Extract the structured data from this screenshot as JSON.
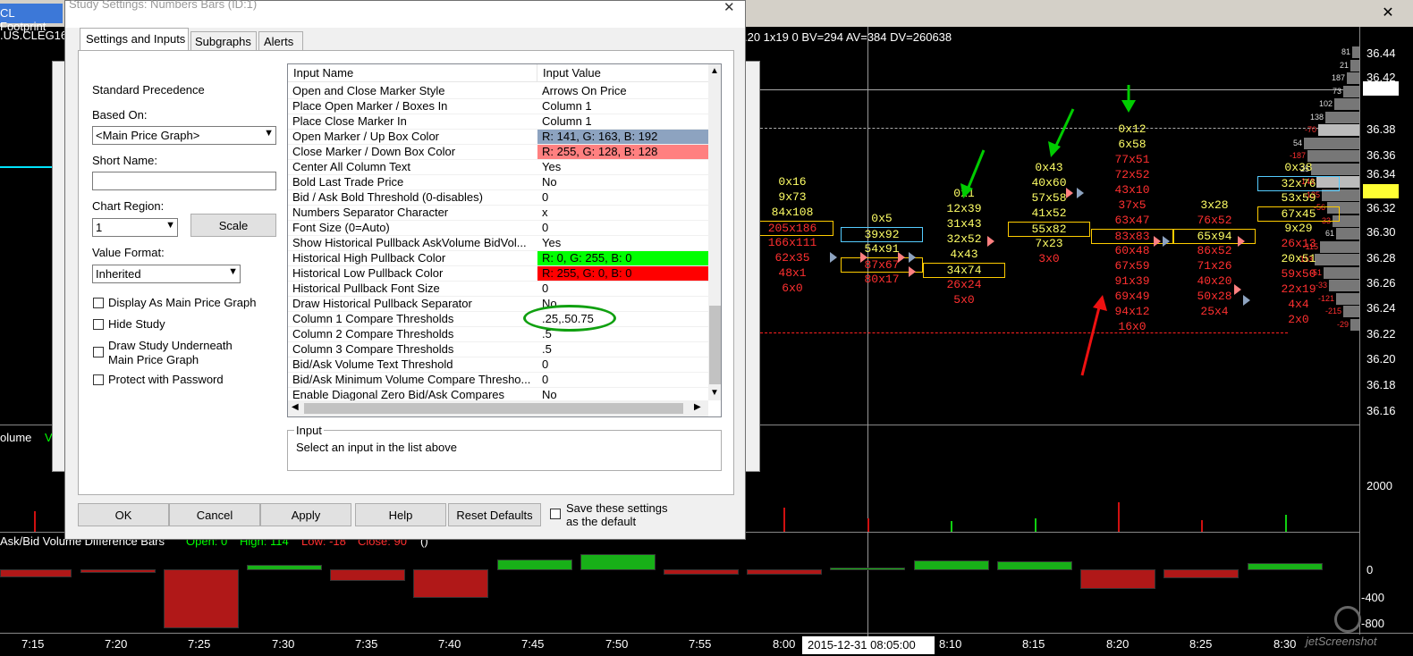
{
  "chart": {
    "tab_title": "CL Footprint",
    "symbol_fragment": ".US.CLEG16",
    "header_stats": ".20  1x19  0  BV=294  AV=384  DV=260638",
    "volume_label": "olume",
    "volume_value_fragment": "V",
    "diff_label": "Ask/Bid Volume Difference Bars",
    "diff_open": "Open: 0",
    "diff_high": "High: 114",
    "diff_low": "Low: -18",
    "diff_close": "Close: 90",
    "diff_paren": "()",
    "cursor_time": "2015-12-31  08:05:00",
    "watermark": "jetScreenshot",
    "price_ticks": [
      "36.44",
      "36.42",
      "36.41",
      "36.38",
      "36.36",
      "36.34",
      "36.33",
      "36.32",
      "36.30",
      "36.28",
      "36.26",
      "36.24",
      "36.22",
      "36.20",
      "36.18",
      "36.16"
    ],
    "volume_ticks": [
      "2000"
    ],
    "diff_ticks": [
      "0",
      "-400",
      "-800"
    ],
    "time_ticks": [
      "7:15",
      "7:20",
      "7:25",
      "7:30",
      "7:35",
      "7:40",
      "7:45",
      "7:50",
      "7:55",
      "8:00",
      "8:10",
      "8:15",
      "8:20",
      "8:25",
      "8:30"
    ],
    "profile_values": [
      "81",
      "21",
      "187",
      "73",
      "102",
      "138",
      "-70",
      "54",
      "-187",
      "25",
      "-143",
      "-135",
      "-56",
      "-33",
      "61",
      "-115",
      "-113",
      "-51",
      "-33",
      "-121",
      "-215",
      "-29"
    ],
    "footprint_cols": [
      {
        "cells": [
          "0x16",
          "9x73",
          "84x108",
          "205x186",
          "166x111",
          "62x35",
          "48x1",
          "6x0"
        ]
      },
      {
        "cells": [
          "0x5",
          "39x92",
          "54x91",
          "87x67",
          "80x17"
        ]
      },
      {
        "cells": [
          "0x1",
          "12x39",
          "31x43",
          "32x52",
          "4x43",
          "34x74",
          "26x24",
          "5x0"
        ]
      },
      {
        "cells": [
          "0x43",
          "40x60",
          "57x58",
          "41x52",
          "55x82",
          "7x23",
          "3x0"
        ]
      },
      {
        "cells": [
          "0x12",
          "6x58",
          "77x51",
          "72x52",
          "43x10",
          "37x5",
          "63x47",
          "83x83",
          "60x48",
          "67x59",
          "91x39",
          "69x49",
          "94x12",
          "16x0"
        ]
      },
      {
        "cells": [
          "3x28",
          "76x52",
          "65x94",
          "86x52",
          "71x26",
          "40x20",
          "50x28",
          "25x4"
        ]
      },
      {
        "cells": [
          "0x38",
          "32x76",
          "53x59",
          "67x45",
          "9x29",
          "26x13",
          "20x51",
          "59x50",
          "22x19",
          "4x4",
          "2x0"
        ]
      }
    ],
    "colors": {
      "green": "#00ff00",
      "red": "#ff3030",
      "yellow": "#ffff66",
      "cyan": "#00ffff"
    }
  },
  "dialog": {
    "title": "Study Settings: Numbers Bars (ID:1)",
    "tabs": [
      "Settings and Inputs",
      "Subgraphs",
      "Alerts"
    ],
    "standard_precedence": "Standard Precedence",
    "based_on_label": "Based On:",
    "based_on_value": "<Main Price Graph>",
    "short_name_label": "Short Name:",
    "short_name_value": "",
    "chart_region_label": "Chart Region:",
    "chart_region_value": "1",
    "scale_button": "Scale",
    "value_format_label": "Value Format:",
    "value_format_value": "Inherited",
    "checkboxes": [
      "Display As Main Price Graph",
      "Hide Study",
      "Draw Study Underneath\nMain Price Graph",
      "Protect with Password"
    ],
    "grid_header": [
      "Input Name",
      "Input Value"
    ],
    "inputs": [
      {
        "name": "Open and Close Marker Style",
        "value": "Arrows On Price",
        "bg": ""
      },
      {
        "name": "Place Open Marker / Boxes In",
        "value": "Column 1",
        "bg": ""
      },
      {
        "name": "Place Close Marker In",
        "value": "Column 1",
        "bg": ""
      },
      {
        "name": "Open Marker / Up Box Color",
        "value": "R: 141, G: 163, B: 192",
        "bg": "#8da3c0"
      },
      {
        "name": "Close Marker / Down Box Color",
        "value": "R: 255, G: 128, B: 128",
        "bg": "#ff8080"
      },
      {
        "name": "Center All Column Text",
        "value": "Yes",
        "bg": ""
      },
      {
        "name": "Bold Last Trade Price",
        "value": "No",
        "bg": ""
      },
      {
        "name": "Bid / Ask Bold Threshold (0-disables)",
        "value": "0",
        "bg": ""
      },
      {
        "name": "Numbers Separator Character",
        "value": "x",
        "bg": ""
      },
      {
        "name": "Font Size (0=Auto)",
        "value": "0",
        "bg": ""
      },
      {
        "name": "Show Historical Pullback AskVolume BidVol...",
        "value": "Yes",
        "bg": ""
      },
      {
        "name": "Historical High Pullback Color",
        "value": "R: 0, G: 255, B: 0",
        "bg": "#00ff00"
      },
      {
        "name": "Historical Low Pullback Color",
        "value": "R: 255, G: 0, B: 0",
        "bg": "#ff0000"
      },
      {
        "name": "Historical Pullback Font Size",
        "value": "0",
        "bg": ""
      },
      {
        "name": "Draw Historical Pullback Separator",
        "value": "No",
        "bg": ""
      },
      {
        "name": "Column 1 Compare Thresholds",
        "value": ".25,.50.75",
        "bg": ""
      },
      {
        "name": "Column 2 Compare Thresholds",
        "value": ".5",
        "bg": ""
      },
      {
        "name": "Column 3 Compare Thresholds",
        "value": ".5",
        "bg": ""
      },
      {
        "name": "Bid/Ask Volume Text Threshold",
        "value": "0",
        "bg": ""
      },
      {
        "name": "Bid/Ask Minimum Volume Compare Thresho...",
        "value": "0",
        "bg": ""
      },
      {
        "name": "Enable Diagonal Zero Bid/Ask Compares",
        "value": "No",
        "bg": ""
      }
    ],
    "input_group_label": "Input",
    "input_help": "Select an input in the list above",
    "buttons": [
      "OK",
      "Cancel",
      "Apply",
      "Help",
      "Reset Defaults"
    ],
    "save_default": "Save these settings\nas the default",
    "close_glyph": "✕"
  }
}
